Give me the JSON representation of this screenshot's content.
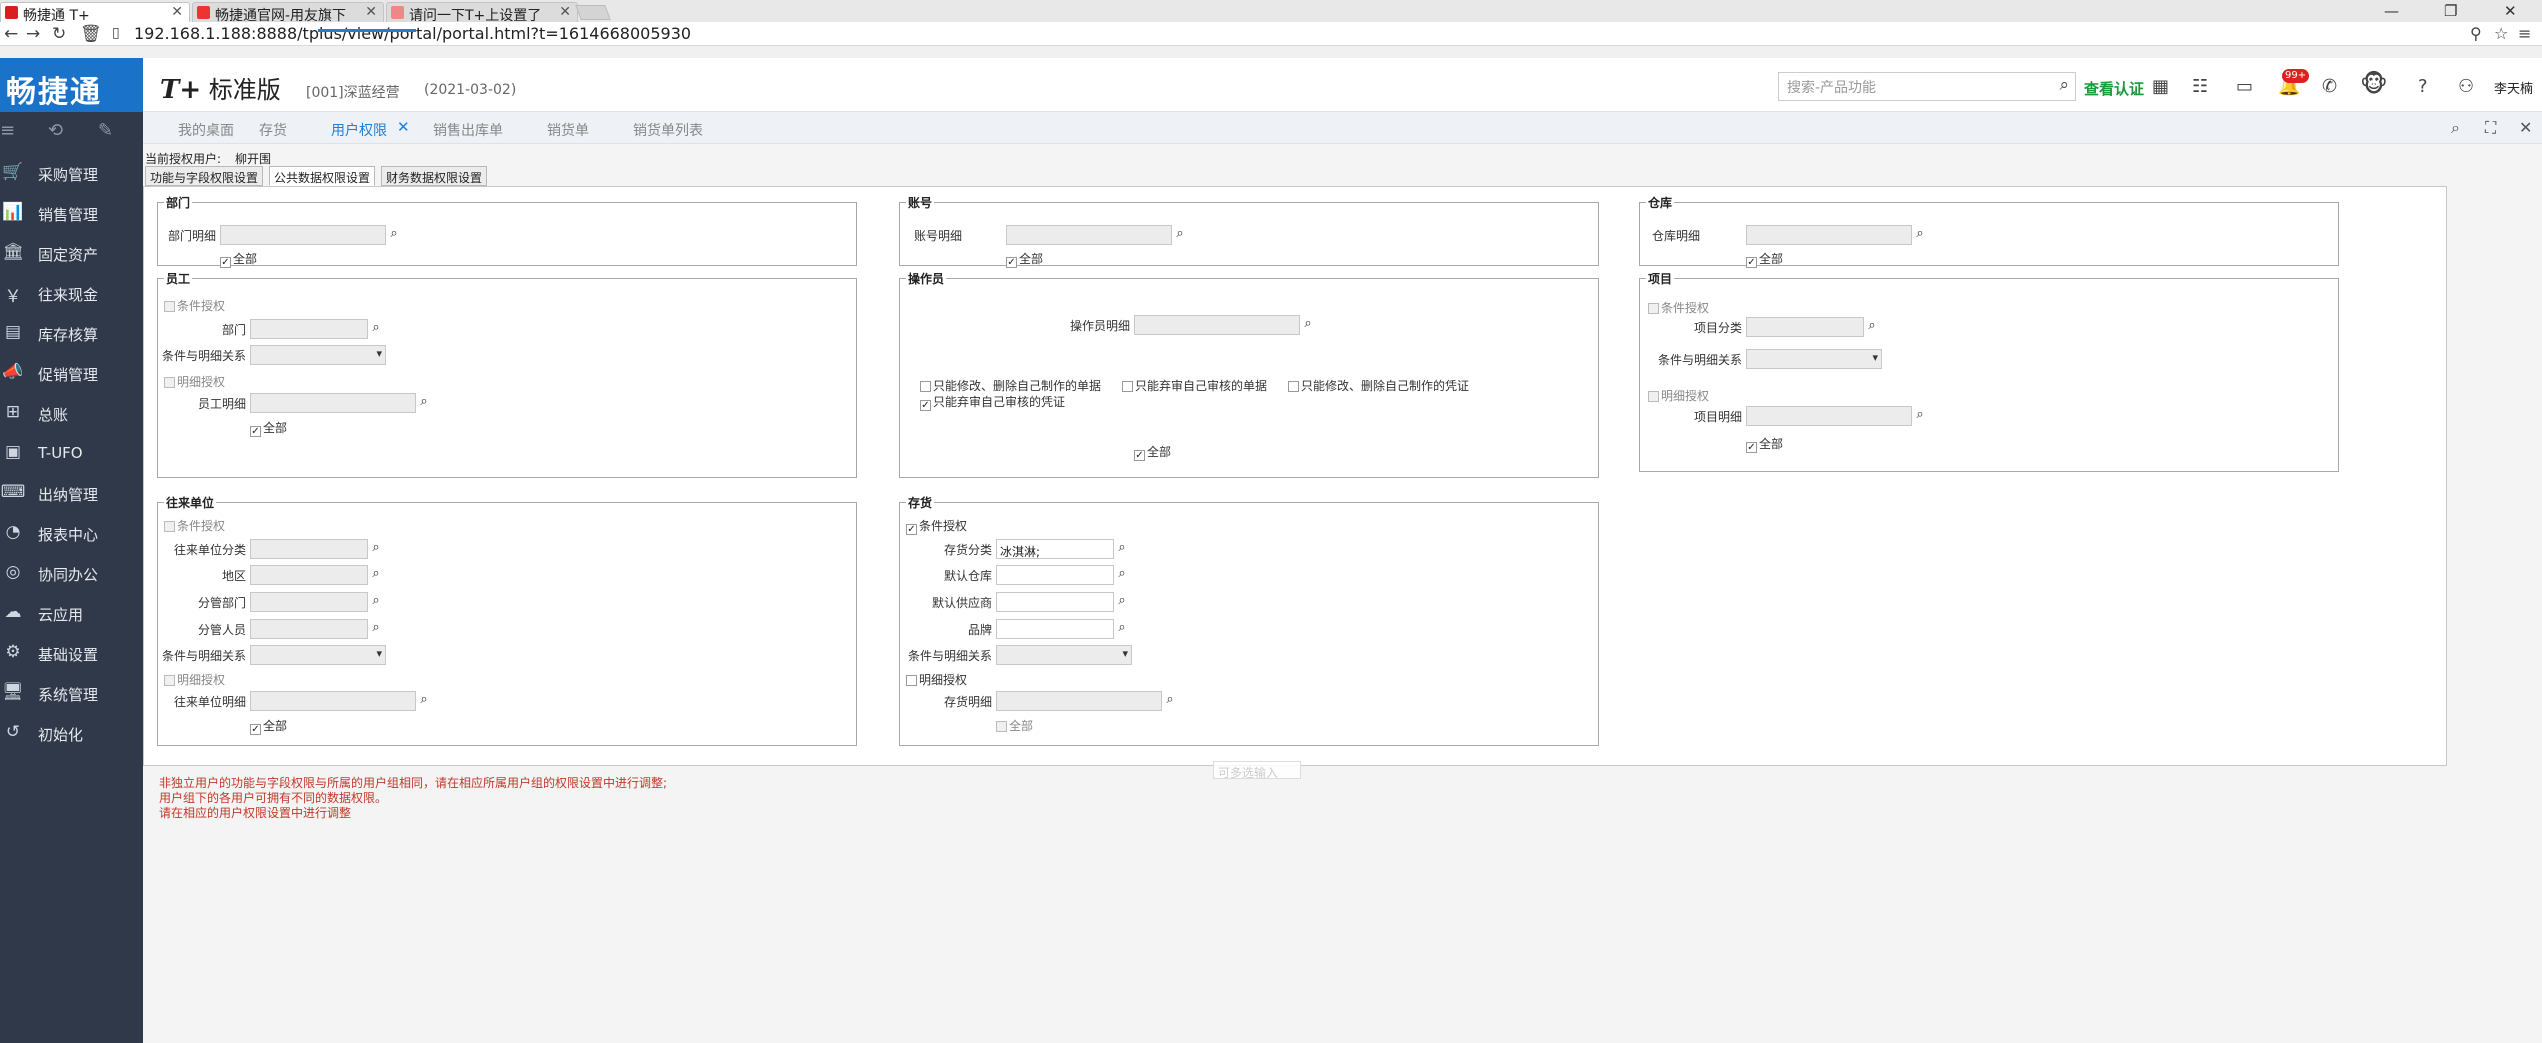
{
  "browser": {
    "tabs": [
      {
        "title": "畅捷通 T+",
        "active": true
      },
      {
        "title": "畅捷通官网-用友旗下",
        "active": false
      },
      {
        "title": "请问一下T+上设置了",
        "active": false
      }
    ],
    "url": "192.168.1.188:8888/tplus/view/portal/portal.html?t=1614668005930"
  },
  "header": {
    "logo": "畅捷通",
    "edition_mark": "T+",
    "edition": "标准版",
    "company": "[001]深蓝经营",
    "date": "(2021-03-02)",
    "search_placeholder": "搜索-产品功能",
    "verify_label": "查看认证",
    "badge": "99+",
    "username": "李天楠"
  },
  "sidebar": {
    "items": [
      {
        "label": "采购管理",
        "icon": "cart-icon"
      },
      {
        "label": "销售管理",
        "icon": "sales-icon"
      },
      {
        "label": "固定资产",
        "icon": "bank-icon"
      },
      {
        "label": "往来现金",
        "icon": "money-icon"
      },
      {
        "label": "库存核算",
        "icon": "stock-icon"
      },
      {
        "label": "促销管理",
        "icon": "promo-icon"
      },
      {
        "label": "总账",
        "icon": "ledger-icon"
      },
      {
        "label": "T-UFO",
        "icon": "ufo-icon"
      },
      {
        "label": "出纳管理",
        "icon": "cashier-icon"
      },
      {
        "label": "报表中心",
        "icon": "report-icon"
      },
      {
        "label": "协同办公",
        "icon": "office-icon"
      },
      {
        "label": "云应用",
        "icon": "cloud-icon"
      },
      {
        "label": "基础设置",
        "icon": "settings-icon"
      },
      {
        "label": "系统管理",
        "icon": "system-icon"
      },
      {
        "label": "初始化",
        "icon": "init-icon"
      }
    ]
  },
  "page_tabs": [
    "我的桌面",
    "存货",
    "用户权限",
    "销售出库单",
    "销货单",
    "销货单列表"
  ],
  "content": {
    "current_user_label": "当前授权用户:",
    "current_user": "柳开围",
    "subtabs": [
      "功能与字段权限设置",
      "公共数据权限设置",
      "财务数据权限设置"
    ],
    "dept": {
      "legend": "部门",
      "detail_label": "部门明细",
      "all_label": "全部"
    },
    "account": {
      "legend": "账号",
      "detail_label": "账号明细",
      "all_label": "全部"
    },
    "warehouse": {
      "legend": "仓库",
      "detail_label": "仓库明细",
      "all_label": "全部"
    },
    "employee": {
      "legend": "员工",
      "cond_auth": "条件授权",
      "dept_label": "部门",
      "relation_label": "条件与明细关系",
      "detail_auth": "明细授权",
      "detail_label": "员工明细",
      "all_label": "全部"
    },
    "operator": {
      "legend": "操作员",
      "detail_label": "操作员明细",
      "opt1": "只能修改、删除自己制作的单据",
      "opt2": "只能弃审自己审核的单据",
      "opt3": "只能修改、删除自己制作的凭证",
      "opt4": "只能弃审自己审核的凭证",
      "all_label": "全部"
    },
    "project": {
      "legend": "项目",
      "cond_auth": "条件授权",
      "category_label": "项目分类",
      "relation_label": "条件与明细关系",
      "detail_auth": "明细授权",
      "detail_label": "项目明细",
      "all_label": "全部"
    },
    "partner": {
      "legend": "往来单位",
      "cond_auth": "条件授权",
      "category_label": "往来单位分类",
      "region_label": "地区",
      "dept_label": "分管部门",
      "staff_label": "分管人员",
      "relation_label": "条件与明细关系",
      "detail_auth": "明细授权",
      "detail_label": "往来单位明细",
      "all_label": "全部"
    },
    "inventory": {
      "legend": "存货",
      "cond_auth": "条件授权",
      "category_label": "存货分类",
      "category_value": "冰淇淋;",
      "warehouse_label": "默认仓库",
      "supplier_label": "默认供应商",
      "brand_label": "品牌",
      "brand_tooltip": "可多选输入",
      "relation_label": "条件与明细关系",
      "detail_auth": "明细授权",
      "detail_label": "存货明细",
      "all_label": "全部"
    },
    "notes": [
      "非独立用户的功能与字段权限与所属的用户组相同，请在相应所属用户组的权限设置中进行调整;",
      "用户组下的各用户可拥有不同的数据权限。",
      "请在相应的用户权限设置中进行调整"
    ]
  },
  "colors": {
    "sidebar_bg": "#2f3949",
    "brand_blue": "#1b73c9",
    "active_tab": "#1f7ed6",
    "verify_green": "#1a9a3c",
    "note_red": "#c0392b"
  }
}
